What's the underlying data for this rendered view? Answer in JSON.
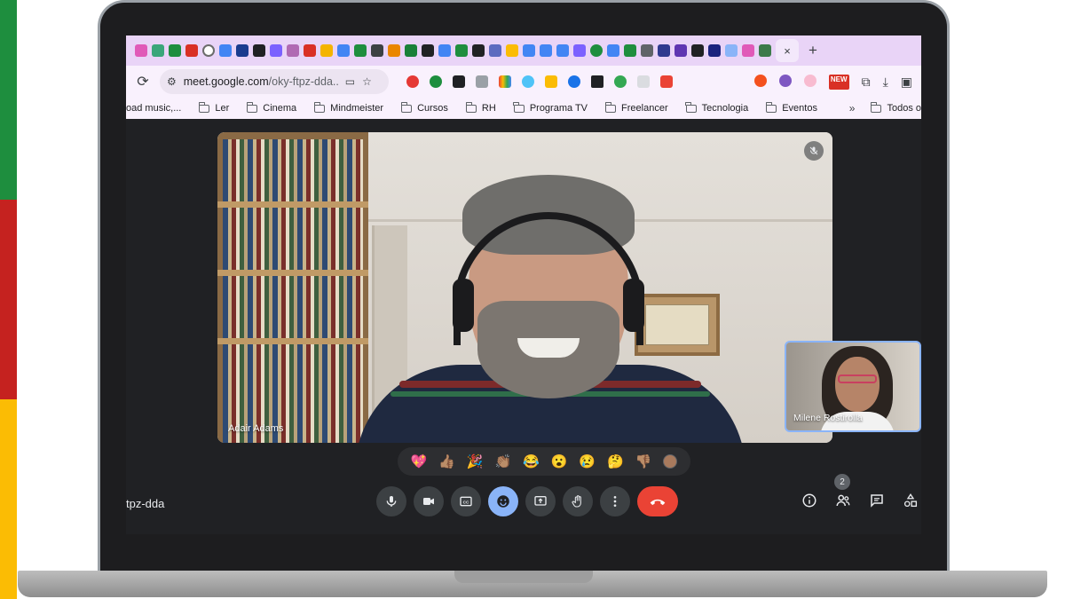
{
  "browser": {
    "url_main": "meet.google.com",
    "url_rest": "/oky-ftpz-dda...",
    "active_tab_close": "×",
    "new_tab": "+",
    "new_badge": "NEW"
  },
  "bookmarks": {
    "items": [
      "oad music,...",
      "Ler",
      "Cinema",
      "Mindmeister",
      "Cursos",
      "RH",
      "Programa TV",
      "Freelancer",
      "Tecnologia",
      "Eventos"
    ],
    "more": "»",
    "other": "Todos o"
  },
  "meeting": {
    "code": "tpz-dda",
    "main_participant": "Adair Adams",
    "self_participant": "Milene Rostirolla",
    "participant_count": "2"
  },
  "reactions": [
    "💖",
    "👍🏽",
    "🎉",
    "👏🏽",
    "😂",
    "😮",
    "😢",
    "🤔",
    "👎🏽"
  ],
  "colors": {
    "tabstrip": "#e9d4f7",
    "accent_blue": "#8ab4f8",
    "end_call": "#ea4335",
    "stage_bg": "#202124"
  }
}
